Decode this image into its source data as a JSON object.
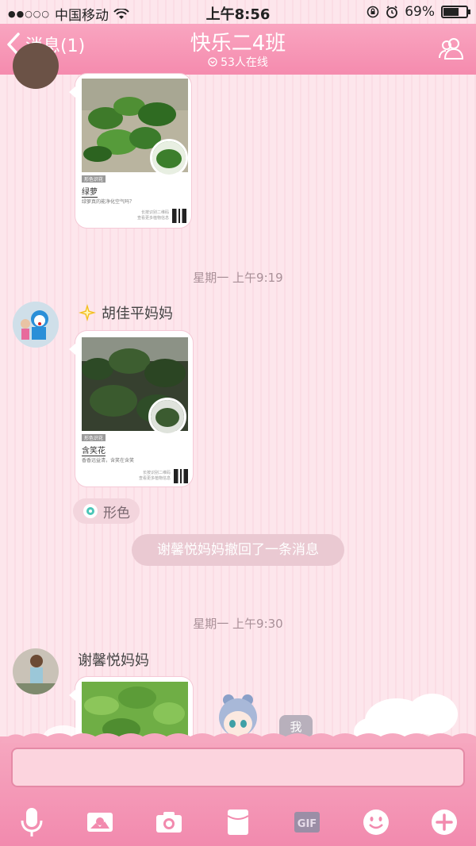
{
  "status_bar": {
    "carrier": "中国移动",
    "time": "上午8:56",
    "battery": "69%",
    "battery_level": 0.69
  },
  "header": {
    "back_label": "消息(1)",
    "title": "快乐二4班",
    "online": "53人在线"
  },
  "messages": {
    "card1": {
      "plant_name": "绿萝",
      "desc": "绿萝真的能净化空气吗？"
    },
    "timestamp1": "星期一 上午9:19",
    "sender1": "胡佳平妈妈",
    "card2": {
      "plant_name": "含笑花",
      "desc": "香香远益清，含笑在含笑"
    },
    "badge": "形色",
    "recall_notice": "谢馨悦妈妈撤回了一条消息",
    "timestamp2": "星期一 上午9:30",
    "sender2": "谢馨悦妈妈",
    "me_label": "我"
  },
  "toolbar": {
    "icons": [
      "microphone-icon",
      "photo-album-icon",
      "camera-icon",
      "red-packet-icon",
      "gif-icon",
      "emoji-icon",
      "plus-icon"
    ],
    "gif_label": "GIF"
  },
  "colors": {
    "header": "#f58bae",
    "background": "#fde3ea",
    "timestamp": "#a99098"
  }
}
